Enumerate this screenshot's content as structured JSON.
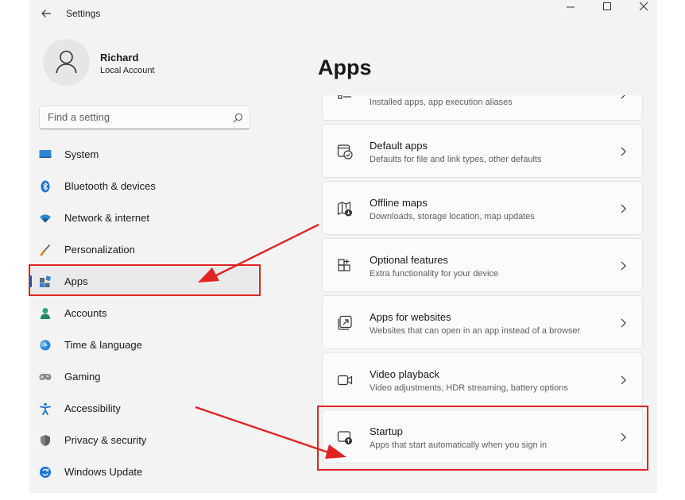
{
  "window": {
    "title": "Settings",
    "icons": {
      "back": "back-arrow-icon",
      "minimize": "minimize-icon",
      "maximize": "maximize-icon",
      "close": "close-icon"
    }
  },
  "user": {
    "name": "Richard",
    "account_type": "Local Account",
    "avatar_icon": "person-icon"
  },
  "search": {
    "placeholder": "Find a setting",
    "value": "",
    "icon": "search-icon"
  },
  "sidebar": {
    "selected": "Apps",
    "items": [
      {
        "label": "System",
        "icon": "monitor-icon"
      },
      {
        "label": "Bluetooth & devices",
        "icon": "bluetooth-icon"
      },
      {
        "label": "Network & internet",
        "icon": "wifi-icon"
      },
      {
        "label": "Personalization",
        "icon": "brush-icon"
      },
      {
        "label": "Apps",
        "icon": "apps-icon"
      },
      {
        "label": "Accounts",
        "icon": "person-icon"
      },
      {
        "label": "Time & language",
        "icon": "globe-clock-icon"
      },
      {
        "label": "Gaming",
        "icon": "gamepad-icon"
      },
      {
        "label": "Accessibility",
        "icon": "accessibility-icon"
      },
      {
        "label": "Privacy & security",
        "icon": "shield-icon"
      },
      {
        "label": "Windows Update",
        "icon": "update-icon"
      }
    ]
  },
  "main": {
    "title": "Apps",
    "cards": [
      {
        "title": "",
        "subtitle": "Installed apps, app execution aliases",
        "icon": "installed-apps-icon"
      },
      {
        "title": "Default apps",
        "subtitle": "Defaults for file and link types, other defaults",
        "icon": "default-apps-icon"
      },
      {
        "title": "Offline maps",
        "subtitle": "Downloads, storage location, map updates",
        "icon": "map-download-icon"
      },
      {
        "title": "Optional features",
        "subtitle": "Extra functionality for your device",
        "icon": "optional-features-icon"
      },
      {
        "title": "Apps for websites",
        "subtitle": "Websites that can open in an app instead of a browser",
        "icon": "open-in-app-icon"
      },
      {
        "title": "Video playback",
        "subtitle": "Video adjustments, HDR streaming, battery options",
        "icon": "video-camera-icon"
      },
      {
        "title": "Startup",
        "subtitle": "Apps that start automatically when you sign in",
        "icon": "startup-icon"
      }
    ]
  },
  "annotations": {
    "highlight_color": "#e02424",
    "highlighted_items": [
      "Apps",
      "Startup"
    ]
  },
  "colors": {
    "accent": "#005fb8",
    "window_bg": "#f3f3f3",
    "card_bg": "#fbfbfb"
  }
}
